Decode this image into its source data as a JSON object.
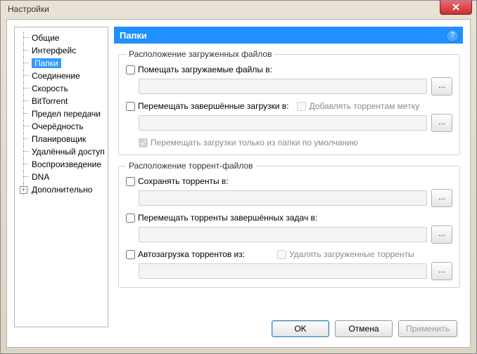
{
  "window": {
    "title": "Настройки"
  },
  "tree": {
    "items": [
      {
        "label": "Общие"
      },
      {
        "label": "Интерфейс"
      },
      {
        "label": "Папки"
      },
      {
        "label": "Соединение"
      },
      {
        "label": "Скорость"
      },
      {
        "label": "BitTorrent"
      },
      {
        "label": "Предел передачи"
      },
      {
        "label": "Очерёдность"
      },
      {
        "label": "Планировщик"
      },
      {
        "label": "Удалённый доступ"
      },
      {
        "label": "Воспроизведение"
      },
      {
        "label": "DNA"
      },
      {
        "label": "Дополнительно"
      }
    ]
  },
  "panel": {
    "header": "Папки",
    "group1": {
      "legend": "Расположение загруженных файлов",
      "cb_put": "Помещать загружаемые файлы в:",
      "cb_move": "Перемещать завершённые загрузки в:",
      "cb_addlabel": "Добавлять торрентам метку",
      "cb_onlydefault": "Перемещать загрузки только из папки по умолчанию"
    },
    "group2": {
      "legend": "Расположение торрент-файлов",
      "cb_save": "Сохранять торренты в:",
      "cb_movetor": "Перемещать торренты завершённых задач в:",
      "cb_autoload": "Автозагрузка торрентов из:",
      "cb_delloaded": "Удалять загруженные торренты"
    },
    "browse": "..."
  },
  "buttons": {
    "ok": "OK",
    "cancel": "Отмена",
    "apply": "Применить"
  }
}
